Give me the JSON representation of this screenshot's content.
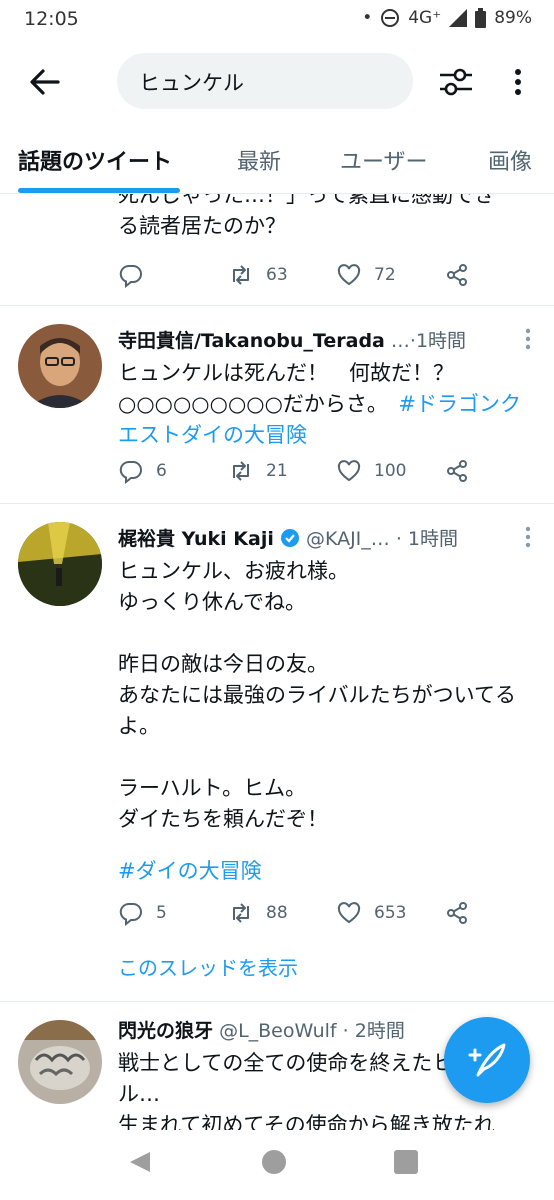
{
  "status_bar": {
    "time": "12:05",
    "network": "4G⁺",
    "battery": "89%"
  },
  "search": {
    "query": "ヒュンケル"
  },
  "tabs": [
    {
      "label": "話題のツイート"
    },
    {
      "label": "最新"
    },
    {
      "label": "ユーザー"
    },
    {
      "label": "画像"
    }
  ],
  "tweets": [
    {
      "body_partial": "死んじゃった…！」って素直に感動でき\nる読者居たのか？",
      "reply_count": "",
      "retweet_count": "63",
      "like_count": "72"
    },
    {
      "name": "寺田貴信/Takanobu_Terada",
      "handle": "…",
      "time": "1時間",
      "body": "ヒュンケルは死んだ！　何故だ！？\n○○○○○○○○○だからさ。　",
      "hashtag": "#ドラゴンクエストダイの大冒険",
      "reply_count": "6",
      "retweet_count": "21",
      "like_count": "100"
    },
    {
      "name": "梶裕貴 Yuki Kaji",
      "handle": "@KAJI_…",
      "time": "1時間",
      "body": "ヒュンケル、お疲れ様。\nゆっくり休んでね。\n\n昨日の敵は今日の友。\nあなたには最強のライバルたちがついてるよ。\n\nラーハルト。ヒム。\nダイたちを頼んだぞ！",
      "hashtag": "#ダイの大冒険",
      "reply_count": "5",
      "retweet_count": "88",
      "like_count": "653",
      "thread_link": "このスレッドを表示"
    },
    {
      "name": "閃光の狼牙",
      "handle": "@L_BeoWulf",
      "time": "2時間",
      "body": "戦士としての全ての使命を終えたヒュンケル…\n生まれて初めてその使命から解き放たれ"
    }
  ],
  "colors": {
    "accent": "#1d9bf0",
    "muted": "#536471",
    "text": "#0f1419"
  },
  "icons": [
    "back-arrow-icon",
    "filter-icon",
    "more-vert-icon",
    "reply-icon",
    "retweet-icon",
    "like-icon",
    "share-icon",
    "compose-icon",
    "verified-icon"
  ]
}
